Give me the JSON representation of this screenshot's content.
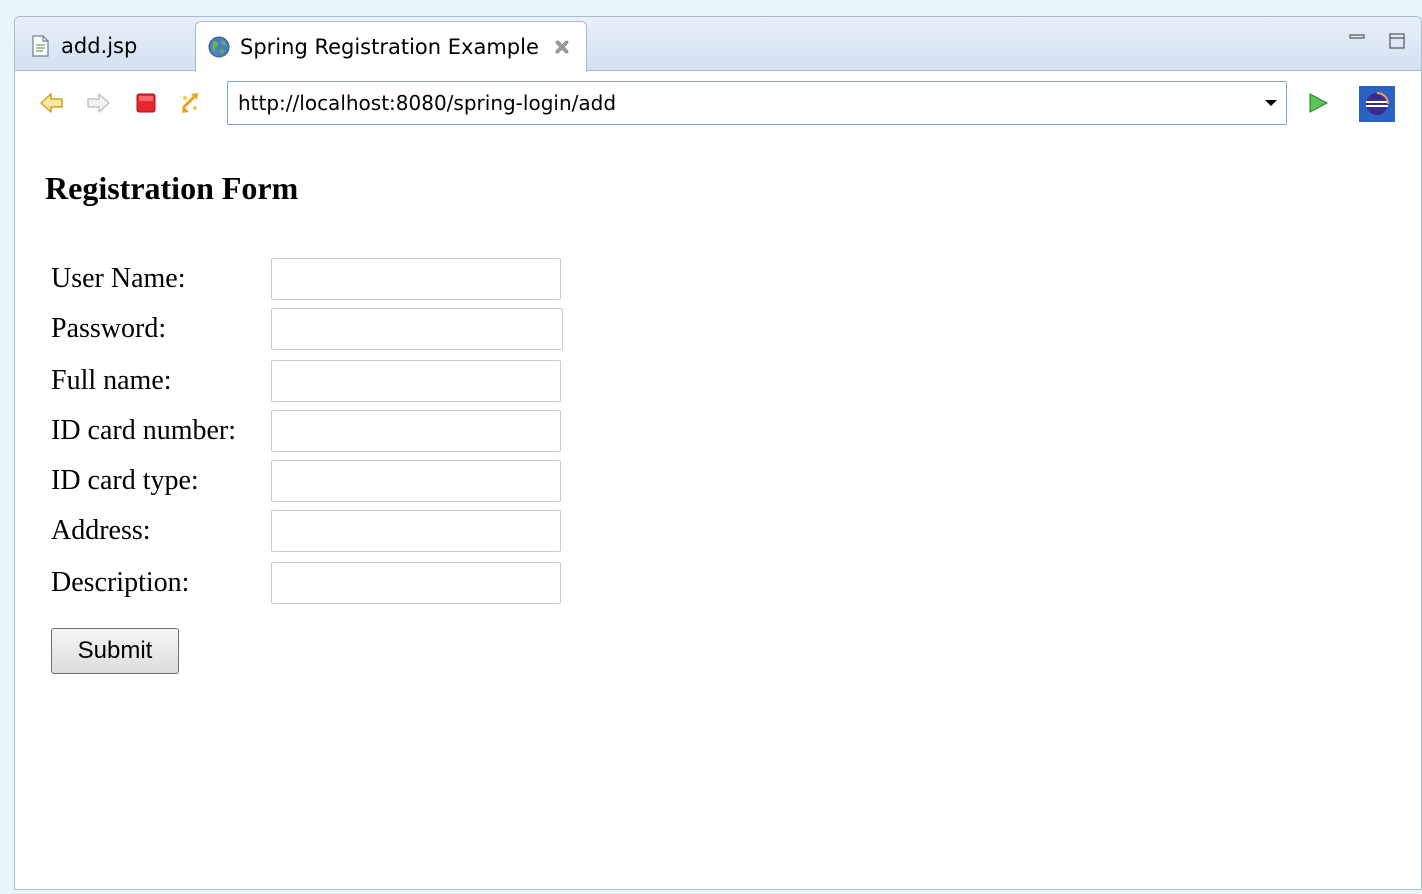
{
  "tabs": [
    {
      "label": "add.jsp",
      "icon": "jsp-file-icon",
      "active": false
    },
    {
      "label": "Spring Registration Example",
      "icon": "globe-icon",
      "active": true
    }
  ],
  "toolbar": {
    "back_icon": "back-arrow-icon",
    "forward_icon": "forward-arrow-icon",
    "stop_icon": "stop-icon",
    "refresh_icon": "refresh-icon",
    "go_icon": "go-icon",
    "eclipse_icon": "eclipse-icon",
    "url": "http://localhost:8080/spring-login/add"
  },
  "page": {
    "title": "Registration Form",
    "fields": [
      {
        "label": "User Name:",
        "value": ""
      },
      {
        "label": "Password:",
        "value": ""
      },
      {
        "label": "Full name:",
        "value": ""
      },
      {
        "label": "ID card number:",
        "value": ""
      },
      {
        "label": "ID card type:",
        "value": ""
      },
      {
        "label": "Address:",
        "value": ""
      },
      {
        "label": "Description:",
        "value": ""
      }
    ],
    "submit_label": "Submit"
  },
  "colors": {
    "background": "#e8f6fc",
    "tabbar": "#d4e1f1",
    "border": "#a9bbd0",
    "url_border": "#7aa7d6",
    "stop_red": "#e8262c",
    "go_green": "#3fae3f"
  }
}
